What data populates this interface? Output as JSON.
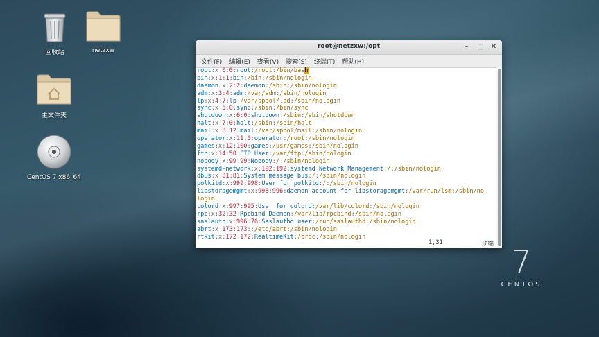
{
  "desktop": {
    "icons": [
      {
        "name": "trash",
        "label": "回收站"
      },
      {
        "name": "folder",
        "label": "netzxw"
      },
      {
        "name": "home-folder",
        "label": "主文件夹"
      },
      {
        "name": "disc",
        "label": "CentOS 7 x86_64"
      }
    ],
    "branding": {
      "number": "7",
      "word": "CENTOS"
    }
  },
  "terminal": {
    "title": "root@netzxw:/opt",
    "menu": [
      "文件(F)",
      "编辑(E)",
      "查看(V)",
      "搜索(S)",
      "终端(T)",
      "帮助(H)"
    ],
    "lines": [
      [
        "root",
        "0",
        "0",
        "root",
        "/root",
        "/bin/bash"
      ],
      [
        "bin",
        "1",
        "1",
        "bin",
        "/bin",
        "/sbin/nologin"
      ],
      [
        "daemon",
        "2",
        "2",
        "daemon",
        "/sbin",
        "/sbin/nologin"
      ],
      [
        "adm",
        "3",
        "4",
        "adm",
        "/var/adm",
        "/sbin/nologin"
      ],
      [
        "lp",
        "4",
        "7",
        "lp",
        "/var/spool/lpd",
        "/sbin/nologin"
      ],
      [
        "sync",
        "5",
        "0",
        "sync",
        "/sbin",
        "/bin/sync"
      ],
      [
        "shutdown",
        "6",
        "0",
        "shutdown",
        "/sbin",
        "/sbin/shutdown"
      ],
      [
        "halt",
        "7",
        "0",
        "halt",
        "/sbin",
        "/sbin/halt"
      ],
      [
        "mail",
        "8",
        "12",
        "mail",
        "/var/spool/mail",
        "/sbin/nologin"
      ],
      [
        "operator",
        "11",
        "0",
        "operator",
        "/root",
        "/sbin/nologin"
      ],
      [
        "games",
        "12",
        "100",
        "games",
        "/usr/games",
        "/sbin/nologin"
      ],
      [
        "ftp",
        "14",
        "50",
        "FTP User",
        "/var/ftp",
        "/sbin/nologin"
      ],
      [
        "nobody",
        "99",
        "99",
        "Nobody",
        "/",
        "/sbin/nologin"
      ],
      [
        "systemd-network",
        "192",
        "192",
        "systemd Network Management",
        "/",
        "/sbin/nologin"
      ],
      [
        "dbus",
        "81",
        "81",
        "System message bus",
        "/",
        "/sbin/nologin"
      ],
      [
        "polkitd",
        "999",
        "998",
        "User for polkitd",
        "/",
        "/sbin/nologin"
      ],
      [
        "libstoragemgmt",
        "998",
        "996",
        "daemon account for libstoragemgmt",
        "/var/run/lsm",
        "/sbin/no"
      ],
      [
        "colord",
        "997",
        "995",
        "User for colord",
        "/var/lib/colord",
        "/sbin/nologin"
      ],
      [
        "rpc",
        "32",
        "32",
        "Rpcbind Daemon",
        "/var/lib/rpcbind",
        "/sbin/nologin"
      ],
      [
        "saslauth",
        "996",
        "76",
        "Saslauthd user",
        "/run/saslauthd",
        "/sbin/nologin"
      ],
      [
        "abrt",
        "173",
        "173",
        "",
        "/etc/abrt",
        "/sbin/nologin"
      ],
      [
        "rtkit",
        "172",
        "172",
        "RealtimeKit",
        "/proc",
        "/sbin/nologin"
      ]
    ],
    "wrap_tail": "login",
    "status": {
      "position": "1,31",
      "scroll": "顶端"
    }
  },
  "colors": {
    "accent_cursor": "#f0a000",
    "user": "#006fb8",
    "number": "#b5273a",
    "path": "#a56a00"
  }
}
